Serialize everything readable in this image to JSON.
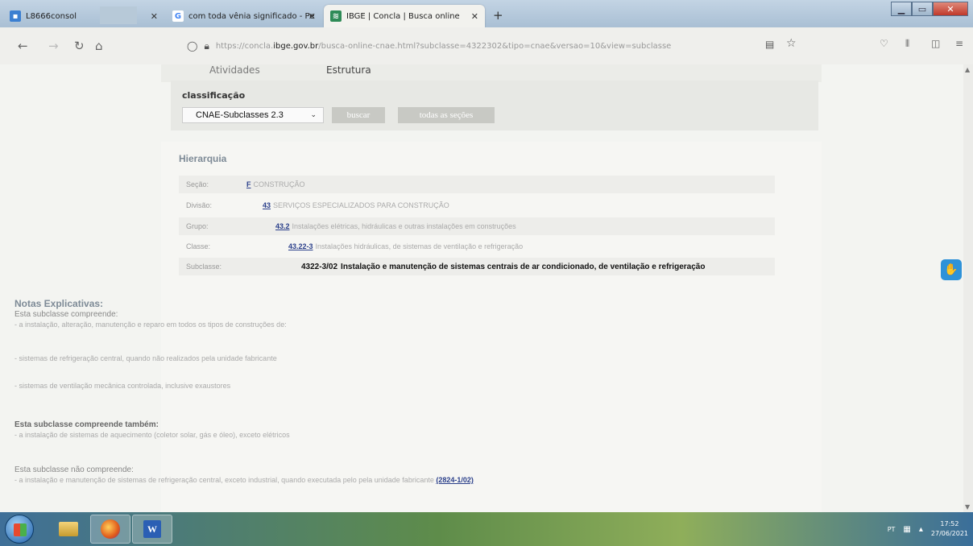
{
  "browser": {
    "tabs": [
      {
        "title": "L8666consol",
        "icon": "document-icon",
        "icon_color": "#3b7fd1"
      },
      {
        "title": "com toda vênia significado - Pe",
        "icon": "google-icon",
        "icon_color": "#4285f4"
      },
      {
        "title": "IBGE | Concla | Busca online",
        "icon": "ibge-icon",
        "icon_color": "#2e8b57"
      }
    ],
    "new_tab_symbol": "+",
    "address": {
      "prefix": "https://concla.",
      "domain": "ibge.gov.br",
      "path": "/busca-online-cnae.html?subclasse=4322302&tipo=cnae&versao=10&view=subclasse"
    }
  },
  "page": {
    "tabs": {
      "atividades": "Atividades",
      "estrutura": "Estrutura"
    },
    "classification": {
      "label": "classificação",
      "selected": "CNAE-Subclasses 2.3",
      "search_button": "buscar",
      "all_sections_button": "todas as seções"
    },
    "hierarchy": {
      "title": "Hierarquia",
      "rows": [
        {
          "label": "Seção:",
          "code": "F",
          "desc": "CONSTRUÇÃO"
        },
        {
          "label": "Divisão:",
          "code": "43",
          "desc": "SERVIÇOS ESPECIALIZADOS PARA CONSTRUÇÃO"
        },
        {
          "label": "Grupo:",
          "code": "43.2",
          "desc": "Instalações elétricas, hidráulicas e outras instalações em construções"
        },
        {
          "label": "Classe:",
          "code": "43.22-3",
          "desc": "Instalações hidráulicas, de sistemas de ventilação e refrigeração"
        },
        {
          "label": "Subclasse:",
          "code": "4322-3/02",
          "desc": "Instalação e manutenção de sistemas centrais de ar condicionado, de ventilação e refrigeração"
        }
      ]
    },
    "notes": {
      "title": "Notas Explicativas:",
      "includes_heading": "Esta subclasse compreende:",
      "includes_items": [
        "- a instalação, alteração, manutenção e reparo em todos os tipos de construções de:",
        "- sistemas de refrigeração central, quando não realizados pela unidade fabricante",
        "- sistemas de ventilação mecânica controlada, inclusive exaustores"
      ],
      "also_heading": "Esta subclasse compreende também:",
      "also_items": [
        "- a instalação de sistemas de aquecimento (coletor solar, gás e óleo), exceto elétricos"
      ],
      "excludes_heading": "Esta subclasse não compreende:",
      "excludes_item": "- a instalação e manutenção de sistemas de refrigeração central, exceto industrial, quando executada pelo pela unidade fabricante",
      "excludes_link": "(2824-1/02)"
    }
  },
  "taskbar": {
    "language": "PT",
    "time": "17:52",
    "date": "27/06/2021"
  }
}
